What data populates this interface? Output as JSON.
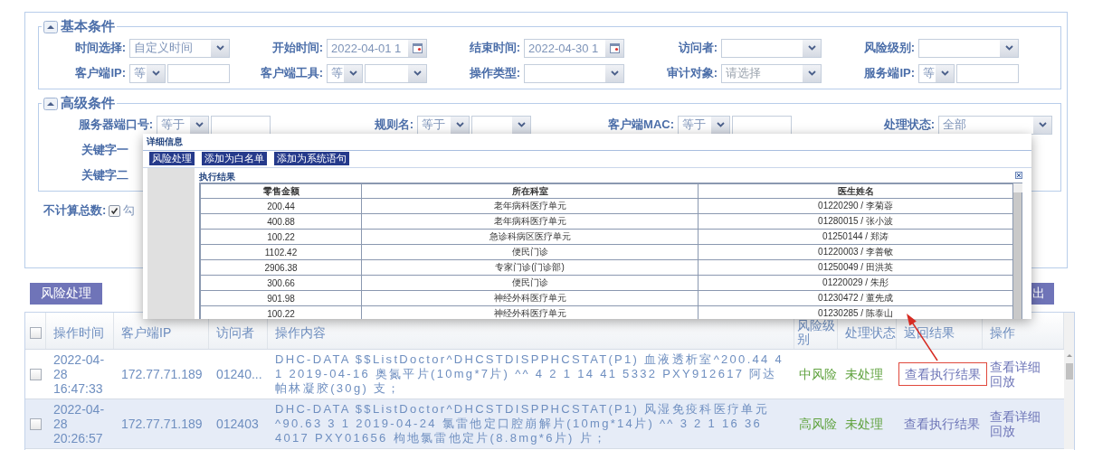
{
  "conditions": {
    "sections": [
      {
        "title": "基本条件",
        "expanded": true,
        "rows": [
          [
            {
              "label": "时间选择:",
              "field": {
                "kind": "select",
                "value": "自定义时间"
              }
            },
            {
              "label": "开始时间:",
              "field": {
                "kind": "date",
                "value": "2022-04-01 1"
              }
            },
            {
              "label": "结束时间:",
              "field": {
                "kind": "date",
                "value": "2022-04-30 1"
              }
            },
            {
              "label": "访问者:",
              "field": {
                "kind": "select"
              }
            },
            {
              "label": "风险级别:",
              "field": {
                "kind": "select"
              }
            }
          ],
          [
            {
              "label": "客户端IP:",
              "field": {
                "kind": "compare",
                "operator": "等"
              }
            },
            {
              "label": "客户端工具:",
              "field": {
                "kind": "compare-select",
                "operator": "等"
              }
            },
            {
              "label": "操作类型:",
              "field": {
                "kind": "select"
              }
            },
            {
              "label": "审计对象:",
              "field": {
                "kind": "select",
                "placeholder": "请选择"
              }
            },
            {
              "label": "服务端IP:",
              "field": {
                "kind": "compare",
                "operator": "等"
              }
            }
          ]
        ]
      },
      {
        "title": "高级条件",
        "expanded": true,
        "rows": [
          [
            {
              "label": "服务器端口号:",
              "field": {
                "kind": "compare",
                "operator": "等于"
              }
            },
            {
              "label": "规则名:",
              "field": {
                "kind": "compare-select",
                "operator": "等于"
              }
            },
            {
              "label": "客户端MAC:",
              "field": {
                "kind": "compare",
                "operator": "等于"
              }
            },
            {
              "label": "处理状态:",
              "field": {
                "kind": "select",
                "value": "全部"
              }
            }
          ],
          [
            {
              "label": "关键字一"
            }
          ],
          [
            {
              "label": "关键字二"
            }
          ]
        ]
      }
    ],
    "count_toggle": {
      "label": "不计算总数:",
      "checked": true,
      "text": "勾"
    }
  },
  "toolbar": {
    "buttons": [
      {
        "label": "风险处理",
        "kind": "left"
      },
      {
        "label": "出",
        "kind": "right"
      }
    ]
  },
  "results": {
    "all_checked": false,
    "columns": [
      "操作时间",
      "客户端IP",
      "访问者",
      "操作内容",
      "风险级别",
      "处理状态",
      "返回结果",
      "操作"
    ],
    "rows": [
      {
        "checked": false,
        "selected": false,
        "highlighted": true,
        "time": "2022-04-28 16:47:33",
        "client_ip": "172.77.71.189",
        "visitor": "01240...",
        "content": "DHC-DATA $$ListDoctor^DHCSTDISPPHCSTAT(P1) 血液透析室^200.44 4 1 2019-04-16 奥氮平片(10mg*7片) ^^ 4 2 1 14 41 5332 PXY912617 阿达帕林凝胶(30g) 支；",
        "risk": "中风险",
        "status": "未处理",
        "result_link": "查看执行结果",
        "actions": [
          "查看详细",
          "回放"
        ]
      },
      {
        "checked": false,
        "selected": true,
        "highlighted": false,
        "time": "2022-04-28 20:26:57",
        "client_ip": "172.77.71.189",
        "visitor": "012403",
        "content": "DHC-DATA $$ListDoctor^DHCSTDISPPHCSTAT(P1) 风湿免疫科医疗单元^90.63 3 1 2019-04-24 氯雷他定口腔崩解片(10mg*14片) ^^ 3 2 1 16 36 4017 PXY01656 枸地氯雷他定片(8.8mg*6片) 片；",
        "risk": "高风险",
        "status": "未处理",
        "result_link": "查看执行结果",
        "actions": [
          "查看详细",
          "回放"
        ]
      }
    ]
  },
  "popup": {
    "title": "详细信息",
    "buttons": [
      "风险处理",
      "添加为白名单",
      "添加为系统语句"
    ],
    "section_title": "执行结果",
    "columns": [
      "零售金额",
      "所在科室",
      "医生姓名"
    ],
    "rows": [
      [
        "200.44",
        "老年病科医疗单元",
        "01220290 / 李菊蓉"
      ],
      [
        "400.88",
        "老年病科医疗单元",
        "01280015 / 张小波"
      ],
      [
        "100.22",
        "急诊科病区医疗单元",
        "01250144 / 郑涛"
      ],
      [
        "1102.42",
        "便民门诊",
        "01220003 / 李善敏"
      ],
      [
        "2906.38",
        "专家门诊(门诊部)",
        "01250049 / 田洪英"
      ],
      [
        "300.66",
        "便民门诊",
        "01220029 / 朱彤"
      ],
      [
        "901.98",
        "神经外科医疗单元",
        "01230472 / 董先成"
      ],
      [
        "100.22",
        "神经外科医疗单元",
        "01230285 / 陈泰山"
      ]
    ]
  }
}
